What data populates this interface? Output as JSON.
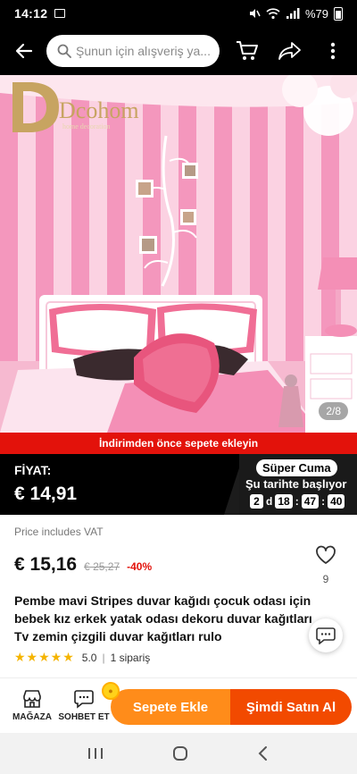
{
  "status_bar": {
    "time": "14:12",
    "battery": "%79"
  },
  "top_bar": {
    "search_placeholder": "Şunun için alışveriş ya..."
  },
  "gallery": {
    "counter": "2/8",
    "brand_logo": "Dcohom",
    "brand_tag": "home decoration"
  },
  "promo_strip": "İndirimden önce sepete ekleyin",
  "price_band": {
    "label": "FİYAT:",
    "price": "€ 14,91",
    "badge": "Süper Cuma",
    "starts_text": "Şu tarihte başlıyor",
    "days": "2",
    "days_unit": "d",
    "hours": "18",
    "minutes": "47",
    "seconds": "40"
  },
  "product": {
    "vat_note": "Price includes VAT",
    "price": "€ 15,16",
    "old_price": "€ 25,27",
    "discount": "-40%",
    "wishlist_count": "9",
    "title": "Pembe mavi Stripes duvar kağıdı çocuk odası için bebek kız erkek yatak odası dekoru duvar kağıtları Tv zemin çizgili duvar kağıtları rulo",
    "rating": "5.0",
    "orders": "1 sipariş"
  },
  "bottom_bar": {
    "store_label": "MAĞAZA",
    "chat_label": "SOHBET ET",
    "add_to_cart": "Sepete Ekle",
    "buy_now": "Şimdi Satın Al"
  },
  "colors": {
    "accent": "#f24a00",
    "cart": "#ff8c1a",
    "promo": "#e3120b",
    "pink": "#f3a7c6"
  }
}
